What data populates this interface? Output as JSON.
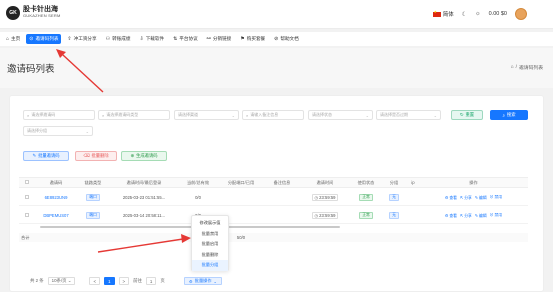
{
  "header": {
    "logo_mark": "GK",
    "logo_cn": "股卡针出海",
    "logo_en": "GUKAZHEN SERM",
    "lang": "简体",
    "money": "0.00 $0",
    "accent": "#1677ff"
  },
  "nav": [
    {
      "icon": "home-icon",
      "glyph": "⌂",
      "label": "主页"
    },
    {
      "icon": "invite-icon",
      "glyph": "⊙",
      "label": "邀请码列表"
    },
    {
      "icon": "share-icon",
      "glyph": "⇧",
      "label": "冲工资分享"
    },
    {
      "icon": "user-icon",
      "glyph": "⚇",
      "label": "转账成绩"
    },
    {
      "icon": "download-icon",
      "glyph": "⇩",
      "label": "下载软件"
    },
    {
      "icon": "platform-icon",
      "glyph": "⇅",
      "label": "平台协议"
    },
    {
      "icon": "link-icon",
      "glyph": "⚯",
      "label": "分销链接"
    },
    {
      "icon": "reward-icon",
      "glyph": "⚑",
      "label": "购买套餐"
    },
    {
      "icon": "help-icon",
      "glyph": "⊘",
      "label": "帮助文档"
    }
  ],
  "page": {
    "title": "邀请码列表",
    "breadcrumb": "邀请码列表"
  },
  "filters": {
    "f1": "请选择邀请码",
    "f2": "请选择邀请码类型",
    "f3": "请选择渠道",
    "f4": "请输入备注信息",
    "f5": "请选择状态",
    "f6": "请选择是否过期",
    "f7": "请选择分组",
    "reset": "重置",
    "search": "搜索"
  },
  "actions": {
    "add": "批量邀请码",
    "del": "批量删除",
    "gen": "生成邀请码"
  },
  "table": {
    "headers": [
      "邀请码",
      "链路类型",
      "邀请时间/最后登录",
      "当前/总有效",
      "分配端口/已用",
      "备注信息",
      "邀请时间",
      "使用状态",
      "分组",
      "ip",
      "操作"
    ],
    "rows": [
      {
        "code": "6E8923UN9",
        "type": "端口",
        "time": "2025-03-23 01:51:55...",
        "valid": "0/0",
        "port": "",
        "remark": "",
        "expire": "23:59:59",
        "status": "正常",
        "group": "无",
        "ops": [
          "查看",
          "分享",
          "编辑",
          "禁用"
        ]
      },
      {
        "code": "DBPEMUS07",
        "type": "端口",
        "time": "2025-03-14 20:58:11...",
        "valid": "0/0",
        "port": "",
        "remark": "",
        "expire": "23:59:59",
        "status": "正常",
        "group": "无",
        "ops": [
          "查看",
          "分享",
          "编辑",
          "禁用"
        ]
      }
    ],
    "total_label": "合计",
    "total_port": "50/0"
  },
  "dropdown": [
    "修改展示值",
    "批量禁用",
    "批量启用",
    "批量删除",
    "批量分组"
  ],
  "pager": {
    "total": "共 2 条",
    "size": "10条/页",
    "prev": "<",
    "page": "1",
    "next": ">",
    "goto": "前往",
    "goto_val": "1",
    "unit": "页",
    "batch": "批量操作"
  },
  "annotation_color": "#e53935"
}
